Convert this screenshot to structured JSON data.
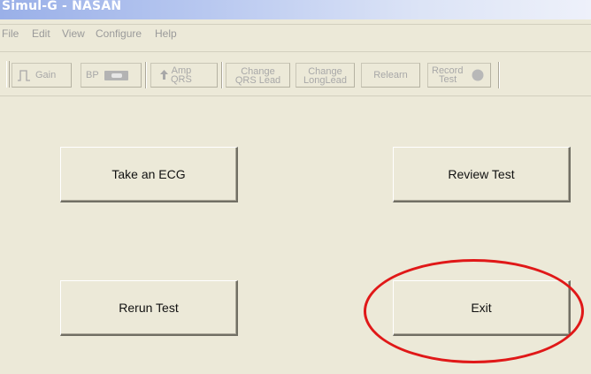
{
  "window": {
    "title": "Simul-G - NASAN"
  },
  "menu": [
    "File",
    "Edit",
    "View",
    "Configure",
    "Help"
  ],
  "toolbar": {
    "gain": "Gain",
    "bp": "BP",
    "amp_qrs": [
      "Amp",
      "QRS"
    ],
    "change_qrs_lead": [
      "Change",
      "QRS Lead"
    ],
    "change_long_lead": [
      "Change",
      "LongLead"
    ],
    "relearn": "Relearn",
    "record_test": [
      "Record",
      "Test"
    ]
  },
  "buttons": {
    "take_ecg": "Take an ECG",
    "review_test": "Review Test",
    "rerun_test": "Rerun Test",
    "exit": "Exit"
  },
  "annotation": {
    "color": "#e01818"
  }
}
